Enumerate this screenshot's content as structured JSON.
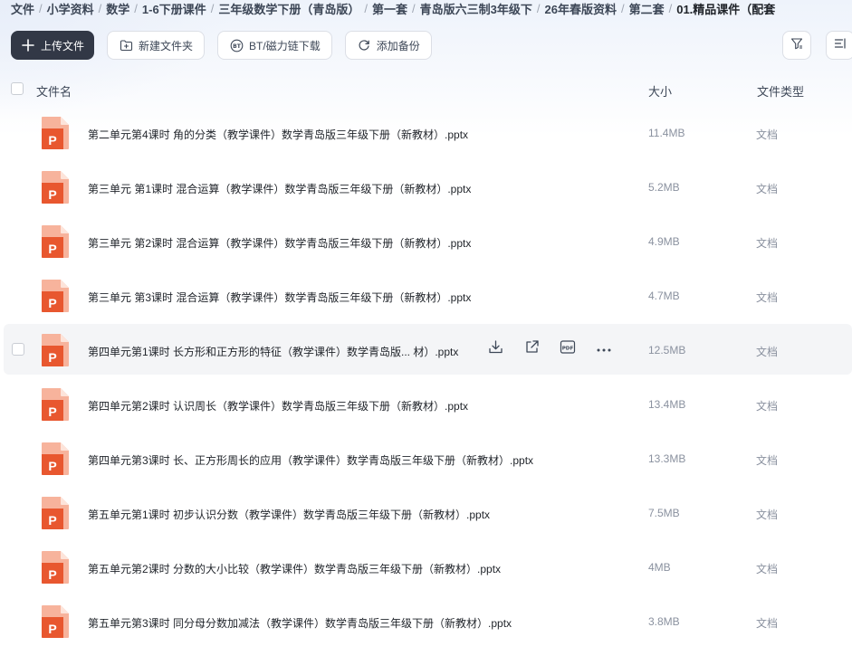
{
  "breadcrumb": [
    "文件",
    "小学资料",
    "数学",
    "1-6下册课件",
    "三年级数学下册（青岛版）",
    "第一套",
    "青岛版六三制3年级下",
    "26年春版资料",
    "第二套",
    "01.精品课件（配套"
  ],
  "toolbar": {
    "upload_label": "上传文件",
    "new_folder_label": "新建文件夹",
    "bt_label": "BT/磁力链下载",
    "backup_label": "添加备份"
  },
  "table": {
    "col_name": "文件名",
    "col_size": "大小",
    "col_type": "文件类型"
  },
  "colors": {
    "ppt_red": "#e8572f",
    "ppt_red_light": "#f7b39c",
    "primary_button": "#323846"
  },
  "files": [
    {
      "name": "第二单元第4课时 角的分类（教学课件）数学青岛版三年级下册（新教材）.pptx",
      "size": "11.4MB",
      "type": "文档"
    },
    {
      "name": "第三单元 第1课时 混合运算（教学课件）数学青岛版三年级下册（新教材）.pptx",
      "size": "5.2MB",
      "type": "文档"
    },
    {
      "name": "第三单元 第2课时 混合运算（教学课件）数学青岛版三年级下册（新教材）.pptx",
      "size": "4.9MB",
      "type": "文档"
    },
    {
      "name": "第三单元 第3课时 混合运算（教学课件）数学青岛版三年级下册（新教材）.pptx",
      "size": "4.7MB",
      "type": "文档"
    },
    {
      "name": "第四单元第1课时 长方形和正方形的特征（教学课件）数学青岛版... 材）.pptx",
      "size": "12.5MB",
      "type": "文档"
    },
    {
      "name": "第四单元第2课时 认识周长（教学课件）数学青岛版三年级下册（新教材）.pptx",
      "size": "13.4MB",
      "type": "文档"
    },
    {
      "name": "第四单元第3课时 长、正方形周长的应用（教学课件）数学青岛版三年级下册（新教材）.pptx",
      "size": "13.3MB",
      "type": "文档"
    },
    {
      "name": "第五单元第1课时 初步认识分数（教学课件）数学青岛版三年级下册（新教材）.pptx",
      "size": "7.5MB",
      "type": "文档"
    },
    {
      "name": "第五单元第2课时 分数的大小比较（教学课件）数学青岛版三年级下册（新教材）.pptx",
      "size": "4MB",
      "type": "文档"
    },
    {
      "name": "第五单元第3课时 同分母分数加减法（教学课件）数学青岛版三年级下册（新教材）.pptx",
      "size": "3.8MB",
      "type": "文档"
    }
  ],
  "hover_row_index": 4
}
